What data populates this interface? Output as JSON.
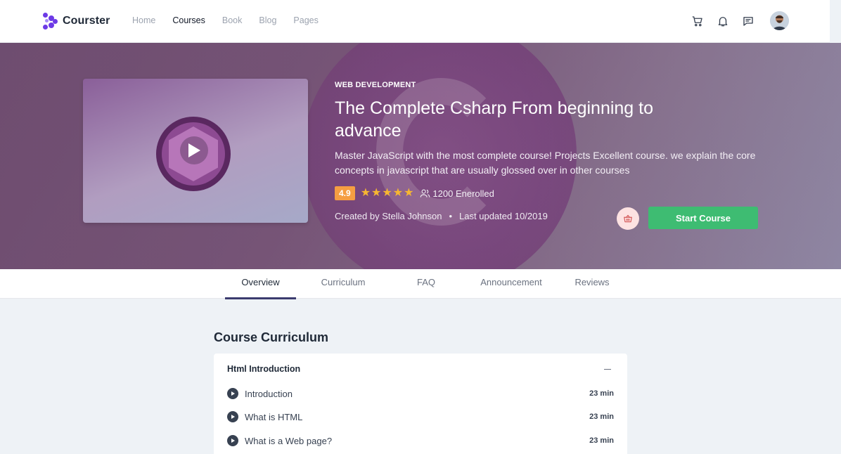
{
  "nav": {
    "brand": "Courster",
    "links": [
      "Home",
      "Courses",
      "Book",
      "Blog",
      "Pages"
    ]
  },
  "hero": {
    "category": "WEB DEVELOPMENT",
    "title": "The Complete Csharp From beginning to advance",
    "description": "Master JavaScript with the most complete course! Projects Excellent course. we explain the core concepts in javascript that are usually glossed over in other courses",
    "rating": "4.9",
    "stars": 5,
    "enrolled": "1200 Enerolled",
    "created_by": "Created by Stella Johnson",
    "last_updated": "Last updated 10/2019",
    "start_button": "Start Course"
  },
  "tabs": [
    "Overview",
    "Curriculum",
    "FAQ",
    "Announcement",
    "Reviews"
  ],
  "curriculum": {
    "title": "Course Curriculum",
    "section": "Html Introduction",
    "lessons": [
      {
        "title": "Introduction",
        "duration": "23 min"
      },
      {
        "title": "What is HTML",
        "duration": "23 min"
      },
      {
        "title": "What is a Web page?",
        "duration": "23 min"
      }
    ]
  },
  "colors": {
    "brand": "#6d3ae6",
    "rating_badge": "#f59e42",
    "star": "#f7b731",
    "start_button": "#3ebc72",
    "active_tab": "#3b3b6e"
  }
}
